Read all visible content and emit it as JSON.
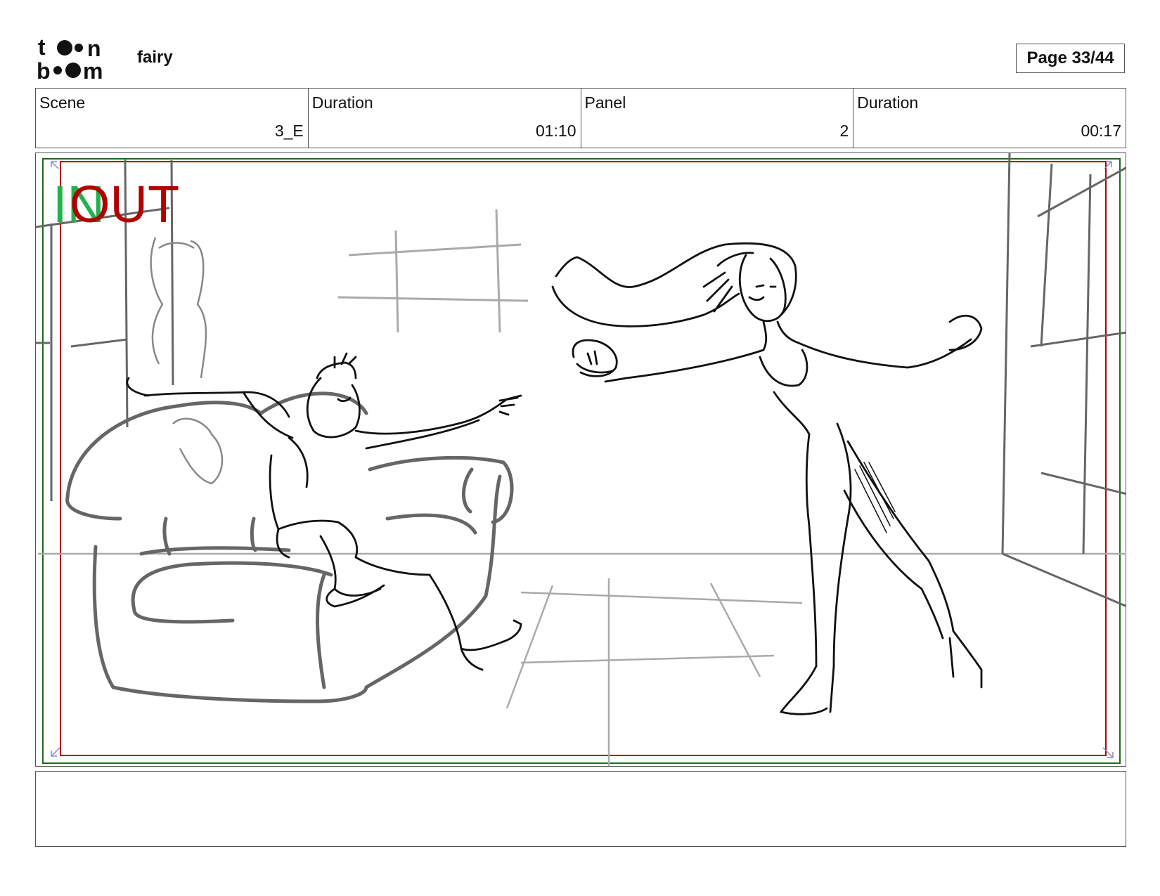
{
  "header": {
    "logo_text": "toon boom",
    "project_title": "fairy",
    "page_indicator": "Page 33/44"
  },
  "info": {
    "scene_label": "Scene",
    "scene_value": "3_E",
    "scene_duration_label": "Duration",
    "scene_duration_value": "01:10",
    "panel_label": "Panel",
    "panel_value": "2",
    "panel_duration_label": "Duration",
    "panel_duration_value": "00:17"
  },
  "panel": {
    "in_marker": "IN",
    "out_marker": "OUT",
    "in_color": "#22b14c",
    "out_color": "#b00000",
    "safe_frame_color": "#1e6b1e",
    "camera_frame_color": "#b00000"
  },
  "caption": {
    "text": ""
  }
}
